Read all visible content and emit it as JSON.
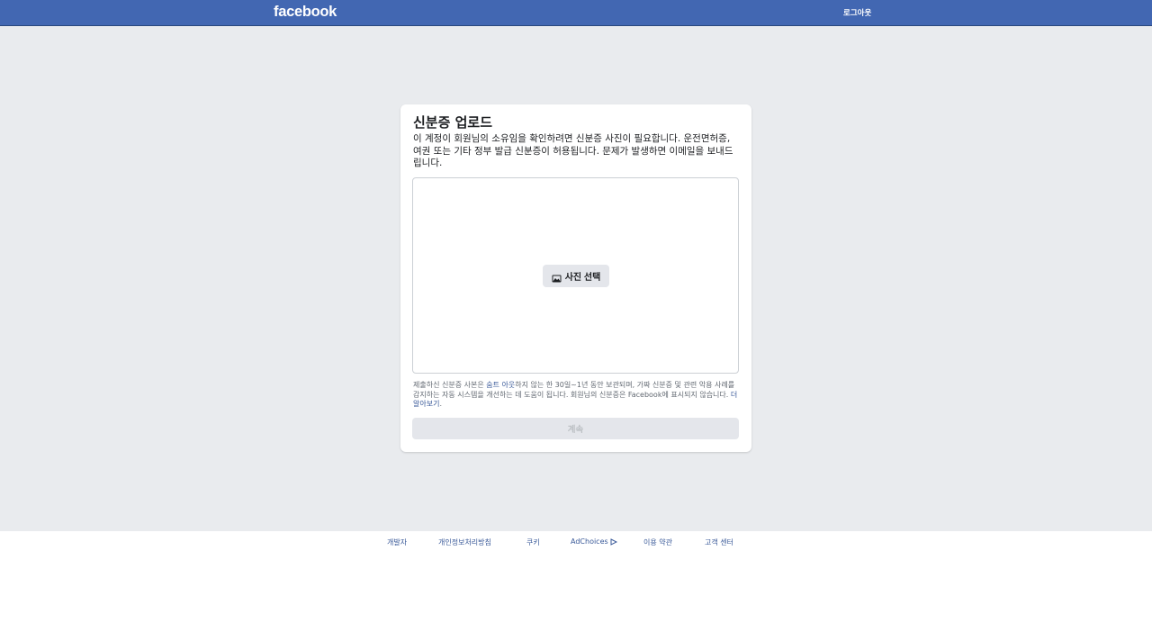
{
  "header": {
    "logo": "facebook",
    "logout_label": "로그아웃"
  },
  "card": {
    "title": "신분증 업로드",
    "description": "이 계정이 회원님의 소유임을 확인하려면 신분증 사진이 필요합니다. 운전면허증, 여권 또는 기타 정부 발급 신분증이 허용됩니다. 문제가 발생하면 이메일을 보내드립니다.",
    "choose_photo_label": "사진 선택",
    "note": {
      "part1": "제출하신 신분증 사본은 ",
      "link1": "숨트 아웃",
      "part2": "하지 않는 한 30일~1년 동안 보관되며, 가짜 신분증 및 관련 악용 사례를 감지하는 자동 시스템을 개선하는 데 도움이 됩니다. 회원님의 신분증은 Facebook에 표시되지 않습니다. ",
      "link2": "더 알아보기",
      "part3": "."
    },
    "continue_label": "계속"
  },
  "footer": {
    "links": [
      "개발자",
      "개인정보처리방침",
      "쿠키",
      "AdChoices",
      "이용 약관",
      "고객 센터"
    ]
  },
  "colors": {
    "brand": "#4267b2",
    "background": "#e9ebee",
    "link": "#385898"
  }
}
